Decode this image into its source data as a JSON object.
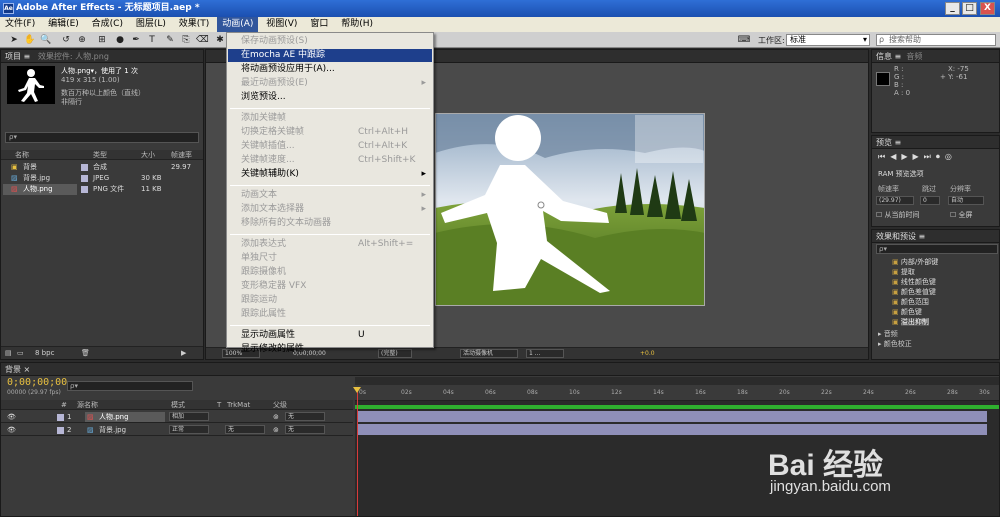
{
  "title": "Adobe After Effects - 无标题项目.aep *",
  "window_buttons": {
    "min": "_",
    "max": "□",
    "close": "X"
  },
  "menu": [
    "文件(F)",
    "编辑(E)",
    "合成(C)",
    "图层(L)",
    "效果(T)",
    "动画(A)",
    "视图(V)",
    "窗口",
    "帮助(H)"
  ],
  "toolbar": {
    "workspace_label": "工作区:",
    "workspace_value": "标准",
    "search_placeholder": "搜索帮助"
  },
  "project": {
    "tab_label": "项目 ≡",
    "effect_tab": "效果控件: 人物.png",
    "asset_name": "人物.png▾，使用了 1 次",
    "asset_size": "419 x 315 (1.00)",
    "asset_color": "数百万种以上颜色（直线）",
    "asset_interlace": "非隔行",
    "search_placeholder": "ρ▾",
    "columns": {
      "name": "名称",
      "type": "类型",
      "size": "大小",
      "fps": "帧速率"
    },
    "items": [
      {
        "name": "背景",
        "type": "合成",
        "size": "",
        "fps": "29.97",
        "color": "#b7b7d6"
      },
      {
        "name": "背景.jpg",
        "type": "JPEG",
        "size": "30 KB",
        "fps": "",
        "color": "#b7b7d6"
      },
      {
        "name": "人物.png",
        "type": "PNG 文件",
        "size": "11 KB",
        "fps": "",
        "color": "#b7b7d6"
      }
    ],
    "bpc": "8 bpc"
  },
  "anim_menu": [
    {
      "label": "保存动画预设(S)",
      "disabled": true
    },
    {
      "label": "在mocha AE 中跟踪",
      "selected": true
    },
    {
      "label": "将动画预设应用于(A)..."
    },
    {
      "label": "最近动画预设(E)",
      "disabled": true,
      "arrow": true
    },
    {
      "label": "浏览预设..."
    },
    {
      "sep": true
    },
    {
      "label": "添加关键帧",
      "disabled": true
    },
    {
      "label": "切换定格关键帧",
      "disabled": true,
      "shortcut": "Ctrl+Alt+H"
    },
    {
      "label": "关键帧插值...",
      "disabled": true,
      "shortcut": "Ctrl+Alt+K"
    },
    {
      "label": "关键帧速度...",
      "disabled": true,
      "shortcut": "Ctrl+Shift+K"
    },
    {
      "label": "关键帧辅助(K)",
      "arrow": true
    },
    {
      "sep": true
    },
    {
      "label": "动画文本",
      "disabled": true,
      "arrow": true
    },
    {
      "label": "添加文本选择器",
      "disabled": true,
      "arrow": true
    },
    {
      "label": "移除所有的文本动画器",
      "disabled": true
    },
    {
      "sep": true
    },
    {
      "label": "添加表达式",
      "disabled": true,
      "shortcut": "Alt+Shift+="
    },
    {
      "label": "单独尺寸",
      "disabled": true
    },
    {
      "label": "跟踪摄像机",
      "disabled": true
    },
    {
      "label": "变形稳定器 VFX",
      "disabled": true
    },
    {
      "label": "跟踪运动",
      "disabled": true
    },
    {
      "label": "跟踪此属性",
      "disabled": true
    },
    {
      "sep": true
    },
    {
      "label": "显示动画属性",
      "shortcut": "U"
    },
    {
      "label": "显示修改的属性"
    }
  ],
  "viewer": {
    "zoom": "100%",
    "timecode": "0;00;00;00",
    "resolution": "(完整)",
    "camera": "活动摄像机",
    "views": "1 ...",
    "exposure": "+0.0"
  },
  "info": {
    "tab": "信息 ≡",
    "audio_tab": "音频",
    "r": "R :",
    "g": "G :",
    "b": "B :",
    "a": "A : 0",
    "x": "X: -75",
    "y": "+ Y: -61"
  },
  "preview": {
    "tab": "预览 ≡",
    "ram": "RAM 预览选项",
    "fps_label": "帧速率",
    "skip_label": "跳过",
    "res_label": "分辨率",
    "fps_value": "(29.97)",
    "skip_value": "0",
    "res_value": "自动",
    "from_current": "从当前时间",
    "fullscreen": "全屏"
  },
  "effects": {
    "tab": "效果和预设 ≡",
    "search": "ρ▾",
    "items": [
      "内部/外部键",
      "提取",
      "线性颜色键",
      "颜色差值键",
      "颜色范围",
      "颜色键",
      "溢出抑制"
    ],
    "folders": [
      "▸ 音频",
      "▸ 颜色校正"
    ]
  },
  "timeline": {
    "tab": "背景 ×",
    "timecode": "0;00;00;00",
    "fps_label": "00000 (29.97 fps)",
    "columns": {
      "num": "#",
      "name": "源名称",
      "mode": "模式",
      "t": "T",
      "trkmat": "TrkMat",
      "parent": "父级"
    },
    "ticks": [
      "0s",
      "02s",
      "04s",
      "06s",
      "08s",
      "10s",
      "12s",
      "14s",
      "16s",
      "18s",
      "20s",
      "22s",
      "24s",
      "26s",
      "28s",
      "30s"
    ],
    "layers": [
      {
        "num": "1",
        "name": "人物.png",
        "mode": "相加",
        "trkmat": "",
        "parent": "无"
      },
      {
        "num": "2",
        "name": "背景.jpg",
        "mode": "正常",
        "trkmat": "无",
        "parent": "无"
      }
    ]
  },
  "watermark": {
    "brand": "Bai 经验",
    "url": "jingyan.baidu.com"
  },
  "colors": {
    "menu_highlight": "#1e3f8c",
    "title_blue": "#2f6fd6",
    "timeline_green": "#2fb02f",
    "layer_bar": "#8f8fb8"
  }
}
